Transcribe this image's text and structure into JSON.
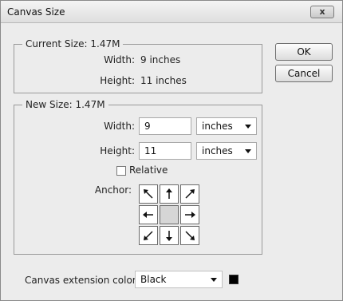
{
  "window": {
    "title": "Canvas Size",
    "close_label": "x"
  },
  "current_size": {
    "legend": "Current Size: 1.47M",
    "width_label": "Width:",
    "width_value": "9 inches",
    "height_label": "Height:",
    "height_value": "11 inches"
  },
  "new_size": {
    "legend": "New Size: 1.47M",
    "width_label": "Width:",
    "width_value": "9",
    "width_unit": "inches",
    "height_label": "Height:",
    "height_value": "11",
    "height_unit": "inches",
    "relative_label": "Relative",
    "relative_checked": false,
    "anchor_label": "Anchor:"
  },
  "buttons": {
    "ok": "OK",
    "cancel": "Cancel"
  },
  "extension": {
    "label": "Canvas extension color:",
    "value": "Black",
    "swatch_color": "#000000"
  },
  "anchor": {
    "icons": [
      "arrow-up-left-icon",
      "arrow-up-icon",
      "arrow-up-right-icon",
      "arrow-left-icon",
      "",
      "arrow-right-icon",
      "arrow-down-left-icon",
      "arrow-down-icon",
      "arrow-down-right-icon"
    ],
    "selected": "center"
  }
}
